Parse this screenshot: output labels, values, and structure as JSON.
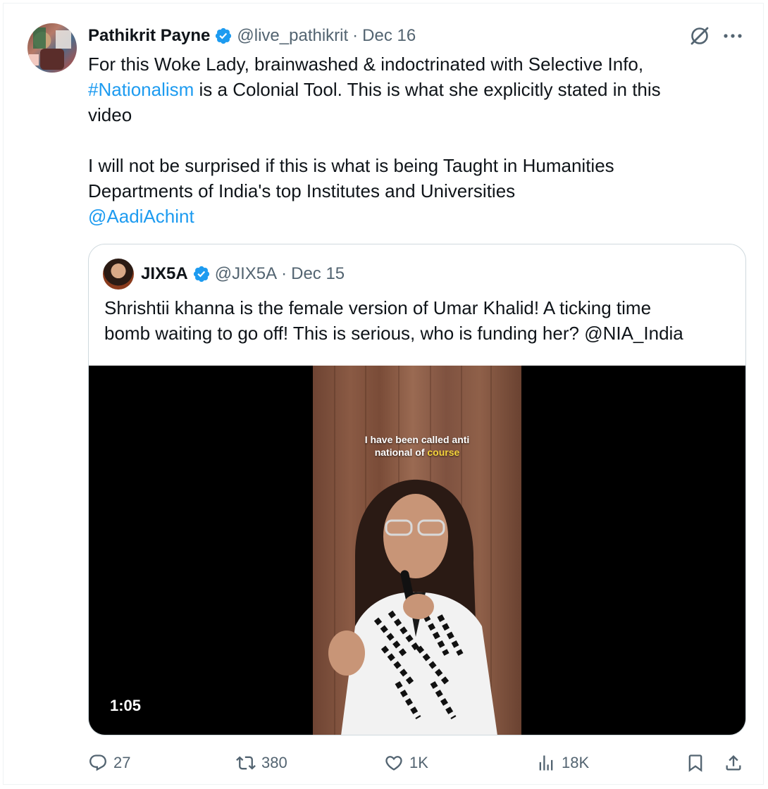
{
  "tweet": {
    "author_name": "Pathikrit Payne",
    "handle": "@live_pathikrit",
    "separator": "·",
    "date": "Dec 16",
    "text_line1": "For this Woke Lady, brainwashed & indoctrinated with Selective Info,",
    "hashtag": "#Nationalism",
    "text_line2_rest": " is a Colonial Tool. This is what she explicitly stated in this",
    "text_line3": "video",
    "text_line4": "I will not be surprised if this is what is being Taught in Humanities",
    "text_line5": "Departments of India's top Institutes and Universities",
    "mention": "@AadiAchint"
  },
  "quote": {
    "author_name": "JIX5A",
    "handle": "@JIX5A",
    "separator": "·",
    "date": "Dec 15",
    "text_line1": "Shrishtii khanna is the female version of Umar Khalid! A ticking time",
    "text_line2": "bomb waiting to go off! This is serious, who is funding her? @NIA_India",
    "video": {
      "caption_line1": "I have been called anti",
      "caption_line2_pre": "national of ",
      "caption_highlight": "course",
      "duration": "1:05"
    }
  },
  "actions": {
    "replies": "27",
    "reposts": "380",
    "likes": "1K",
    "views": "18K"
  },
  "colors": {
    "link": "#1d9bf0",
    "verified": "#1d9bf0",
    "secondary_text": "#536471"
  },
  "icons": [
    "verified-badge-icon",
    "grok-icon",
    "more-icon",
    "reply-icon",
    "repost-icon",
    "like-icon",
    "views-icon",
    "bookmark-icon",
    "share-icon"
  ]
}
